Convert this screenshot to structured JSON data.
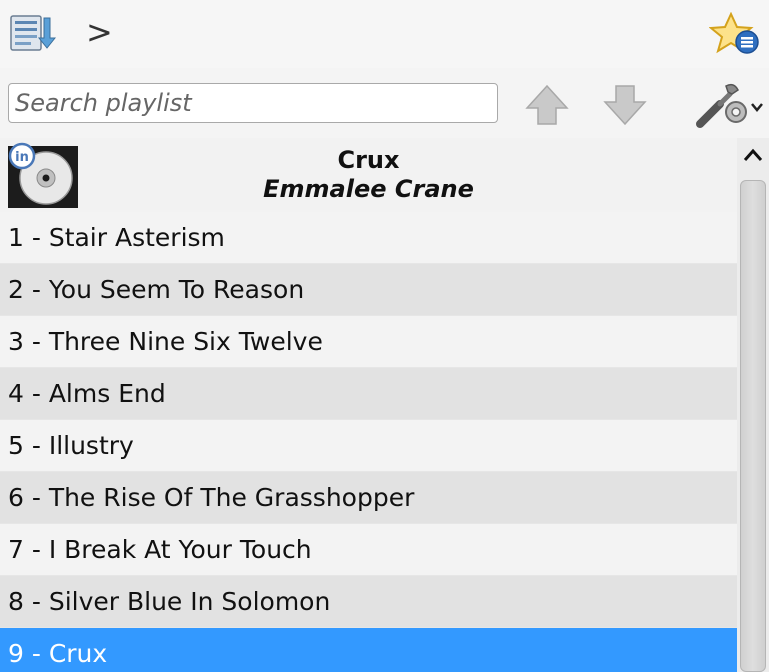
{
  "toolbar": {
    "breadcrumb_arrow": ">",
    "playlist_icon": "playlist-icon",
    "favorites_icon": "star-list-icon"
  },
  "search": {
    "placeholder": "Search playlist",
    "value": ""
  },
  "controls": {
    "move_up_icon": "up-arrow-icon",
    "move_down_icon": "down-arrow-icon",
    "settings_icon": "tools-icon"
  },
  "album": {
    "title": "Crux",
    "artist": "Emmalee Crane"
  },
  "tracks": [
    {
      "label": "1 - Stair Asterism"
    },
    {
      "label": "2 - You Seem To Reason"
    },
    {
      "label": "3 - Three Nine Six Twelve"
    },
    {
      "label": "4 - Alms End"
    },
    {
      "label": "5 - Illustry"
    },
    {
      "label": "6 - The Rise Of The Grasshopper"
    },
    {
      "label": "7 - I Break At Your Touch"
    },
    {
      "label": "8 - Silver Blue In Solomon"
    },
    {
      "label": "9 - Crux"
    }
  ],
  "selected_track": "9 - Crux",
  "colors": {
    "selection": "#3399ff",
    "row_alt": "#e2e2e2",
    "row": "#f3f3f3"
  }
}
